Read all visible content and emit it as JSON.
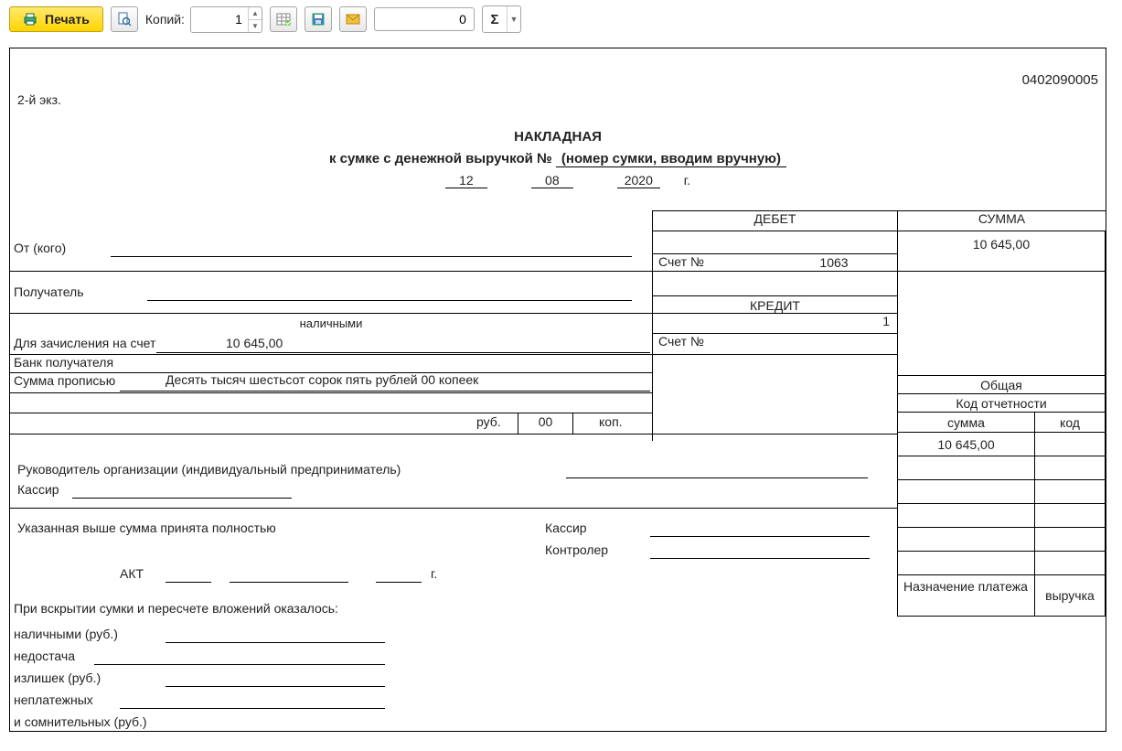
{
  "toolbar": {
    "print": "Печать",
    "copies_label": "Копий:",
    "copies_value": "1",
    "num_value": "0",
    "icons": {
      "print": "print-icon",
      "preview": "preview-icon",
      "table": "table-icon",
      "save": "save-icon",
      "mail": "mail-icon",
      "sigma": "Σ"
    }
  },
  "doc": {
    "code": "0402090005",
    "copy": "2-й экз.",
    "title": "НАКЛАДНАЯ",
    "subtitle_prefix": "к сумке с денежной выручкой № ",
    "bag_placeholder": "(номер сумки, вводим вручную)",
    "date": {
      "day": "12",
      "month": "08",
      "year": "2020",
      "year_suffix": "г."
    },
    "from_label": "От (кого)",
    "recipient_label": "Получатель",
    "cash_label": "наличными",
    "deposit_label": "Для зачисления на счет",
    "deposit_amount": "10 645,00",
    "bank_label": "Банк получателя",
    "words_label": "Сумма прописью",
    "words_value": "Десять тысяч шестьсот сорок пять рублей 00 копеек",
    "rub": "руб.",
    "rub_frac": "00",
    "kop": "коп.",
    "debit": "ДЕБЕТ",
    "credit": "КРЕДИТ",
    "account": "Счет №",
    "debit_account": "1063",
    "credit_one": "1",
    "sum_header": "СУММА",
    "sum_value": "10 645,00",
    "overall": "Общая",
    "report_code": "Код отчетности",
    "sum_col": "сумма",
    "code_col": "код",
    "sum_cell": "10 645,00",
    "purpose_label": "Назначение платежа",
    "purpose_value": "выручка",
    "head_label": "Руководитель организации (индивидуальный предприниматель)",
    "cashier": "Кассир",
    "accepted": "Указанная выше сумма принята полностью",
    "cashier2": "Кассир",
    "controller": "Контролер",
    "akt": "АКТ",
    "akt_suffix": "г.",
    "open_label": "При вскрытии сумки и пересчете вложений оказалось:",
    "rows": {
      "cash": "наличными (руб.)",
      "shortage": "недостача",
      "excess": "излишек (руб.)",
      "nonpay": "неплатежных",
      "doubt": "и сомнительных (руб.)"
    }
  }
}
